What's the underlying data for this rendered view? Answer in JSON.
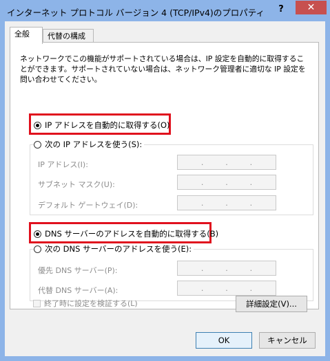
{
  "window": {
    "title": "インターネット プロトコル バージョン 4 (TCP/IPv4)のプロパティ",
    "help": "?",
    "close": "✕"
  },
  "tabs": [
    "全般",
    "代替の構成"
  ],
  "description": "ネットワークでこの機能がサポートされている場合は、IP 設定を自動的に取得することができます。サポートされていない場合は、ネットワーク管理者に適切な IP 設定を問い合わせてください。",
  "ip_section": {
    "auto_label": "IP アドレスを自動的に取得する(O)",
    "manual_label": "次の IP アドレスを使う(S):",
    "auto_selected": true,
    "fields": [
      {
        "label": "IP アドレス(I):",
        "value": ".   .   ."
      },
      {
        "label": "サブネット マスク(U):",
        "value": ".   .   ."
      },
      {
        "label": "デフォルト ゲートウェイ(D):",
        "value": ".   .   ."
      }
    ]
  },
  "dns_section": {
    "auto_label": "DNS サーバーのアドレスを自動的に取得する(B)",
    "manual_label": "次の DNS サーバーのアドレスを使う(E):",
    "auto_selected": true,
    "fields": [
      {
        "label": "優先 DNS サーバー(P):",
        "value": ".   .   ."
      },
      {
        "label": "代替 DNS サーバー(A):",
        "value": ".   .   ."
      }
    ]
  },
  "validate_label": "終了時に設定を検証する(L)",
  "advanced_button": "詳細設定(V)...",
  "ok_button": "OK",
  "cancel_button": "キャンセル"
}
